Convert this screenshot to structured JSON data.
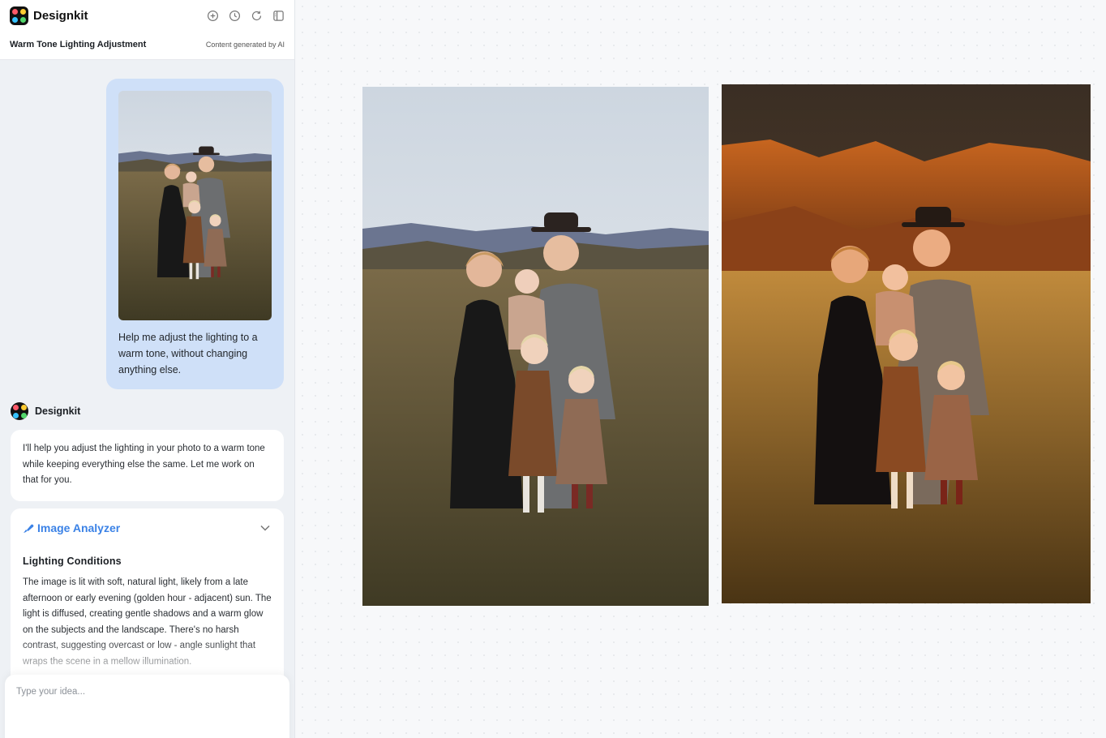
{
  "app": {
    "name": "Designkit"
  },
  "header": {
    "title": "Warm Tone Lighting Adjustment",
    "ai_note": "Content generated by AI",
    "icons": [
      "add-chat-icon",
      "history-icon",
      "refresh-icon",
      "panel-toggle-icon"
    ]
  },
  "chat": {
    "user_message": "Help me adjust the lighting to a warm tone, without changing anything else.",
    "bot_name": "Designkit",
    "bot_message": "I'll help you adjust the lighting in your photo to a warm tone while keeping everything else the same. Let me work on that for you.",
    "tool": {
      "name": "Image Analyzer",
      "section_title": "Lighting Conditions",
      "body": "The image is lit with soft, natural light, likely from a late afternoon or early evening (golden hour - adjacent) sun. The light is diffused, creating gentle shadows and a warm glow on the subjects and the landscape. There's no harsh contrast, suggesting overcast or low - angle sunlight that wraps the scene in a mellow illumination."
    }
  },
  "composer": {
    "placeholder": "Type your idea..."
  },
  "colors": {
    "accent": "#3b82e6",
    "user_bubble": "#cfe0f8"
  }
}
